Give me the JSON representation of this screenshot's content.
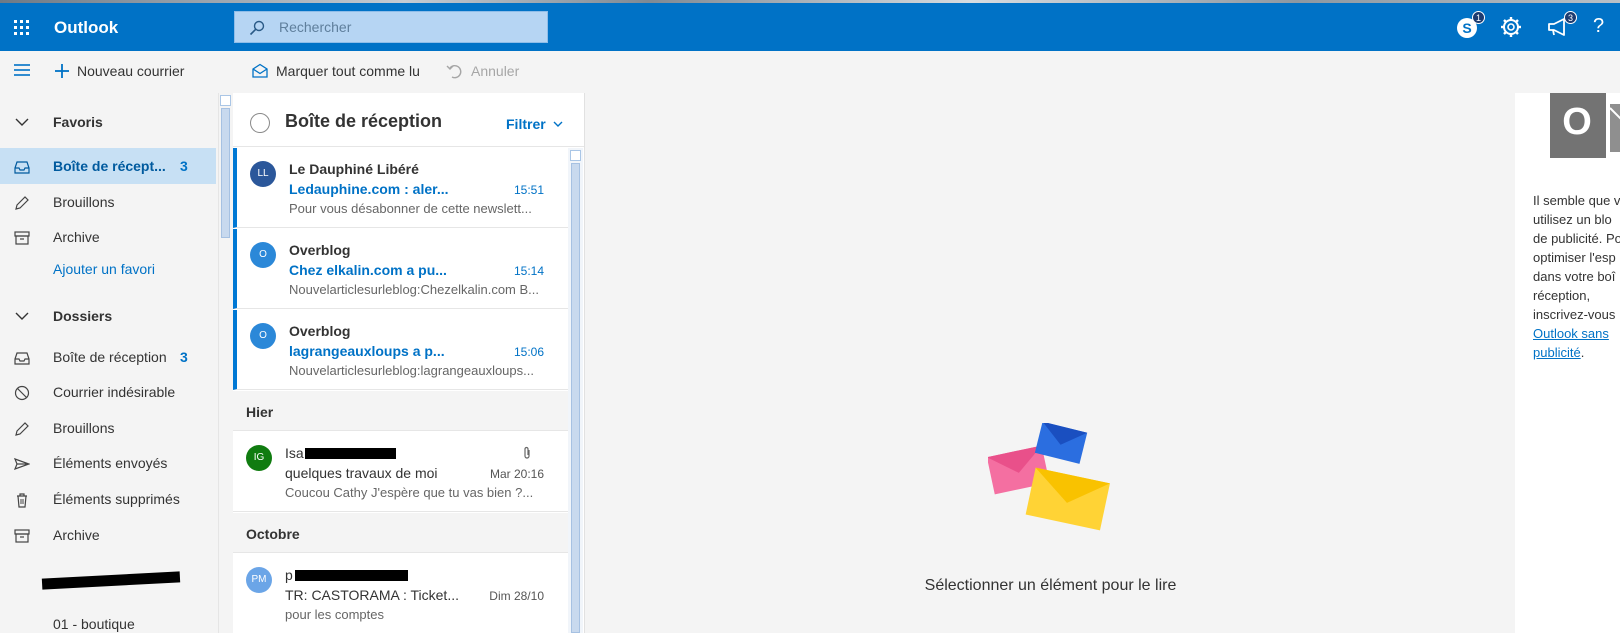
{
  "app": {
    "name": "Outlook"
  },
  "header": {
    "search_placeholder": "Rechercher",
    "skype_badge": "1",
    "feedback_badge": "3",
    "help_label": "?"
  },
  "commands": {
    "new_mail": "Nouveau courrier",
    "mark_all_read": "Marquer tout comme lu",
    "undo": "Annuler"
  },
  "nav": {
    "favorites_header": "Favoris",
    "favorites": [
      {
        "label": "Boîte de récept...",
        "count": "3",
        "icon": "inbox-icon",
        "active": true
      },
      {
        "label": "Brouillons",
        "icon": "pencil-icon"
      },
      {
        "label": "Archive",
        "icon": "archive-icon"
      }
    ],
    "add_favorite": "Ajouter un favori",
    "folders_header": "Dossiers",
    "folders": [
      {
        "label": "Boîte de réception",
        "count": "3",
        "icon": "inbox-icon"
      },
      {
        "label": "Courrier indésirable",
        "icon": "junk-icon"
      },
      {
        "label": "Brouillons",
        "icon": "pencil-icon"
      },
      {
        "label": "Éléments envoyés",
        "icon": "send-icon"
      },
      {
        "label": "Éléments supprimés",
        "icon": "trash-icon"
      },
      {
        "label": "Archive",
        "icon": "archive-icon"
      },
      {
        "label": "01 - boutique"
      }
    ]
  },
  "list": {
    "title": "Boîte de réception",
    "filter": "Filtrer",
    "groups": {
      "yesterday": "Hier",
      "october": "Octobre"
    },
    "messages": [
      {
        "initials": "LL",
        "sender": "Le Dauphiné Libéré",
        "subject": "Ledauphine.com : aler...",
        "time": "15:51",
        "preview": "Pour vous désabonner de cette newslett...",
        "color": "#2b579a"
      },
      {
        "initials": "O",
        "sender": "Overblog",
        "subject": "Chez elkalin.com a pu...",
        "time": "15:14",
        "preview": "Nouvelarticlesurleblog:Chezelkalin.com B...",
        "color": "#2b88d8"
      },
      {
        "initials": "O",
        "sender": "Overblog",
        "subject": "lagrangeauxloups a p...",
        "time": "15:06",
        "preview": "Nouvelarticlesurleblog:lagrangeauxloups...",
        "color": "#2b88d8"
      },
      {
        "initials": "IG",
        "sender": "Isa",
        "subject": "quelques travaux de moi",
        "time": "Mar 20:16",
        "preview": "Coucou Cathy J'espère que tu vas bien ?...",
        "color": "#107c10",
        "attachment": true
      },
      {
        "initials": "PM",
        "sender": "p",
        "subject": "TR: CASTORAMA : Ticket...",
        "time": "Dim 28/10",
        "preview": "pour les comptes",
        "color": "#6ba5e7"
      }
    ]
  },
  "reading": {
    "empty_text": "Sélectionner un élément pour le lire"
  },
  "ad": {
    "lines": [
      "Il semble que v",
      "utilisez un blo",
      "de publicité. Po",
      "optimiser l'esp",
      "dans votre boî",
      "réception,",
      "inscrivez-vous"
    ],
    "link_line1": "Outlook sans",
    "link_line2": "publicité",
    "end": "."
  }
}
